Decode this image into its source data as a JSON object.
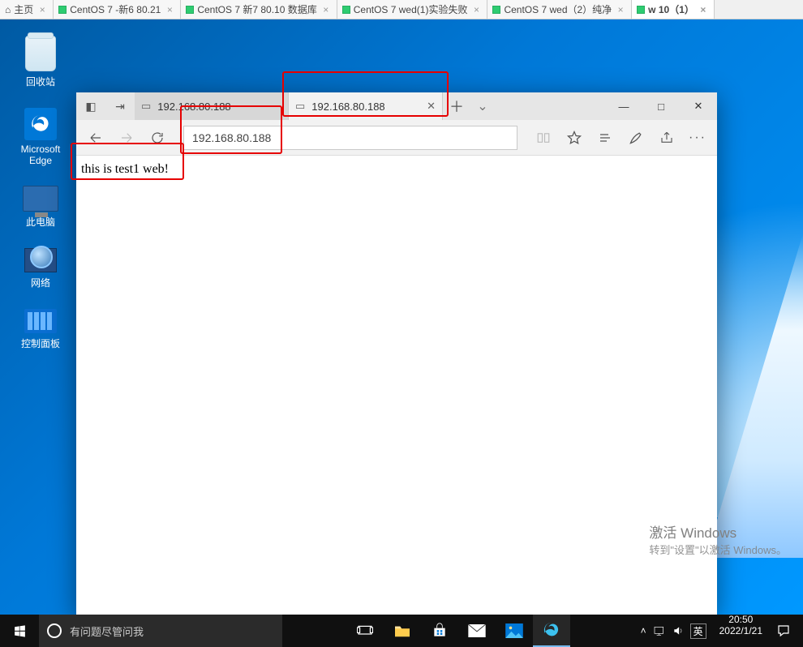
{
  "vm_tabs": [
    {
      "label": "主页",
      "type": "home",
      "active": false
    },
    {
      "label": "CentOS 7 -新6 80.21",
      "type": "vm",
      "active": false
    },
    {
      "label": "CentOS 7 新7 80.10 数据库",
      "type": "vm",
      "active": false
    },
    {
      "label": "CentOS 7 wed(1)实验失败",
      "type": "vm",
      "active": false
    },
    {
      "label": "CentOS 7 wed（2）纯净",
      "type": "vm",
      "active": false
    },
    {
      "label": "w 10（1）",
      "type": "vm",
      "active": true
    }
  ],
  "desktop_icons": {
    "recycle": "回收站",
    "edge": "Microsoft Edge",
    "pc": "此电脑",
    "network": "网络",
    "control": "控制面板"
  },
  "watermark": {
    "title": "激活 Windows",
    "sub": "转到\"设置\"以激活 Windows。"
  },
  "edge": {
    "tabs": {
      "bg_label": "192.168.80.188",
      "active_label": "192.168.80.188"
    },
    "new_tab_glyph": "＋",
    "addr": "192.168.80.188",
    "page_text": "this is test1 web!",
    "sys": {
      "min": "—",
      "max": "□",
      "close": "✕"
    }
  },
  "taskbar": {
    "search_placeholder": "有问题尽管问我",
    "ime": "英",
    "time": "20:50",
    "date": "2022/1/21"
  }
}
